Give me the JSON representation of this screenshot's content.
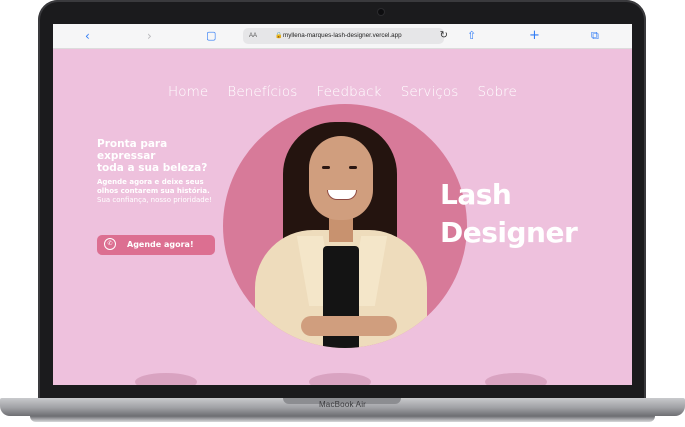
{
  "device": {
    "model_label": "MacBook Air"
  },
  "browser": {
    "aa_label": "AA",
    "url": "myllena-marques-lash-designer.vercel.app",
    "icons": [
      "back-icon",
      "forward-icon",
      "book-icon",
      "lock-icon",
      "reload-icon",
      "share-icon",
      "add-icon",
      "tabs-icon"
    ]
  },
  "nav": {
    "items": [
      "Home",
      "Benefícios",
      "Feedback",
      "Serviços",
      "Sobre"
    ]
  },
  "hero": {
    "headline": "Pronta para\nexpressar\ntoda a sua beleza?",
    "desc_bold": "Agende agora e deixe seus olhos contarem sua história.",
    "desc_rest": " Sua confiança, nosso prioridade!",
    "cta_label": "Agende agora!",
    "title_line1": "Lash",
    "title_line2": "Designer"
  },
  "colors": {
    "page_bg": "#eec1dd",
    "circle": "#d77a99",
    "cta": "#dc6f91",
    "link": "#2f7bf5"
  }
}
